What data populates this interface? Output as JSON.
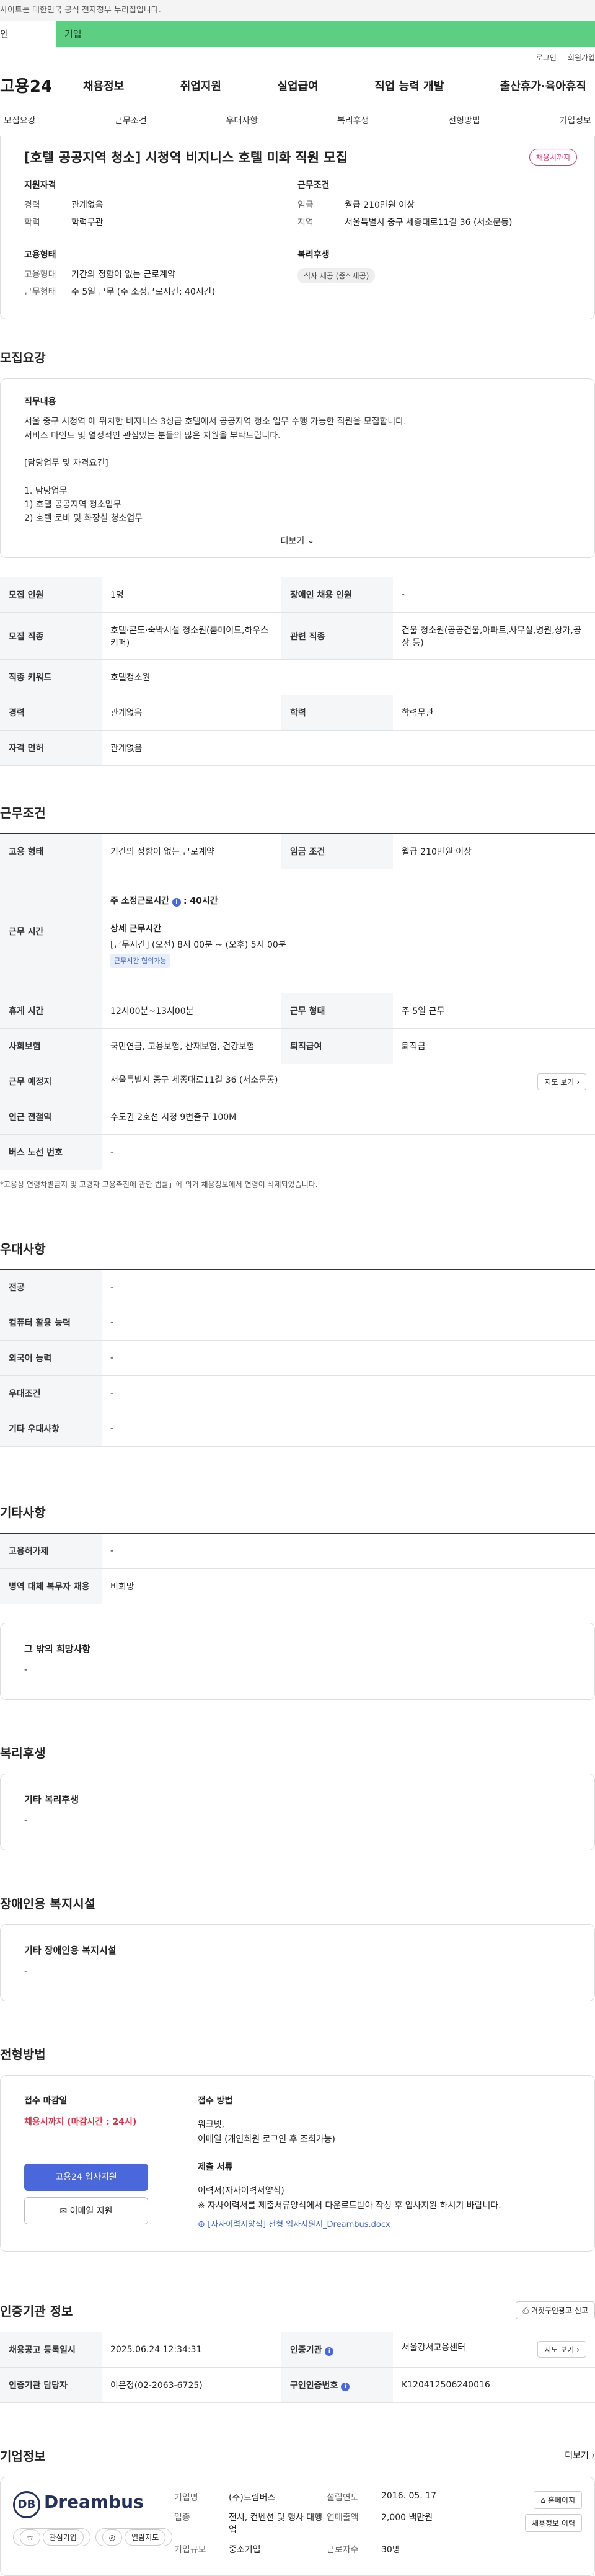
{
  "gov_notice": "사이트는 대한민국 공식 전자정부 누리집입니다.",
  "top_tabs": [
    "인",
    "기업"
  ],
  "util_links": [
    "로그인",
    "회원가입"
  ],
  "logo": "고용24",
  "gnb": [
    "채용정보",
    "취업지원",
    "실업급여",
    "직업 능력 개발",
    "출산휴가·육아휴직"
  ],
  "anchors": [
    "모집요강",
    "근무조건",
    "우대사항",
    "복리후생",
    "전형방법",
    "기업정보"
  ],
  "job": {
    "title": "[호텔 공공지역 청소] 시청역 비지니스 호텔 미화 직원 모집",
    "status": "채용시까지",
    "qualification": {
      "heading": "지원자격",
      "rows": [
        [
          "경력",
          "관계없음"
        ],
        [
          "학력",
          "학력무관"
        ]
      ]
    },
    "conditions": {
      "heading": "근무조건",
      "rows": [
        [
          "임금",
          "월급 210만원 이상"
        ],
        [
          "지역",
          "서울특별시 중구 세종대로11길 36 (서소문동)"
        ]
      ]
    },
    "employment": {
      "heading": "고용형태",
      "rows": [
        [
          "고용형태",
          "기간의 정함이 없는 근로계약"
        ],
        [
          "근무형태",
          "주 5일 근무 (주 소정근로시간: 40시간)"
        ]
      ]
    },
    "welfare": {
      "heading": "복리후생",
      "chip": "식사 제공 (중식제공)"
    }
  },
  "recruit": {
    "title": "모집요강",
    "duty_heading": "직무내용",
    "duty_lines": [
      "서울 중구 시청역 에 위치한 비지니스 3성급 호텔에서 공공지역 청소 업무 수행 가능한 직원을 모집합니다.",
      "서비스 마인드 및 열정적인 관심있는 분들의 많은 지원을 부탁드립니다.",
      "",
      "[담당업무 및 자격요건]",
      "",
      "1. 담당업무",
      " 1) 호텔 공공지역 청소업무",
      " 2) 호텔 로비 및 화장실 청소업무"
    ],
    "more": "더보기",
    "table": [
      [
        "모집 인원",
        "1명",
        "장애인 채용 인원",
        "-"
      ],
      [
        "모집 직종",
        "호텔·콘도·숙박시설 청소원(룸메이드,하우스키퍼)",
        "관련 직종",
        "건물 청소원(공공건물,아파트,사무실,병원,상가,공장 등)"
      ],
      [
        "직종 키워드",
        "호텔청소원"
      ],
      [
        "경력",
        "관계없음",
        "학력",
        "학력무관"
      ],
      [
        "자격 면허",
        "관계없음"
      ]
    ]
  },
  "work": {
    "title": "근무조건",
    "type": [
      "고용 형태",
      "기간의 정함이 없는 근로계약",
      "임금 조건",
      "월급 210만원 이상"
    ],
    "hours_label": "근무 시간",
    "hours_week": "주 소정근로시간",
    "hours_week_val": ": 40시간",
    "hours_detail_head": "상세 근무시간",
    "hours_detail": "[근무시간] (오전) 8시 00분 ~ (오후) 5시 00분",
    "hours_tag": "근무시간 협의가능",
    "rows": [
      [
        "휴게 시간",
        "12시00분~13시00분",
        "근무 형태",
        "주 5일 근무"
      ],
      [
        "사회보험",
        "국민연금, 고용보험, 산재보험, 건강보험",
        "퇴직급여",
        "퇴직금"
      ]
    ],
    "place_label": "근무 예정지",
    "place": "서울특별시 중구 세종대로11길 36 (서소문동)",
    "map_btn": "지도 보기",
    "station_label": "인근 전철역",
    "station": "수도권 2호선 시청 9번출구 100M",
    "bus_label": "버스 노선 번호",
    "bus": "-",
    "note": "*고용상 연령차별금지 및 고령자 고용촉진에 관한 법률」에 의거 채용정보에서 연령이 삭제되었습니다."
  },
  "pref": {
    "title": "우대사항",
    "rows": [
      [
        "전공",
        "-"
      ],
      [
        "컴퓨터 활용 능력",
        "-"
      ],
      [
        "외국어 능력",
        "-"
      ],
      [
        "우대조건",
        "-"
      ],
      [
        "기타 우대사항",
        "-"
      ]
    ]
  },
  "etc": {
    "title": "기타사항",
    "rows": [
      [
        "고용허가제",
        "-"
      ],
      [
        "병역 대체 복무자 채용",
        "비희망"
      ]
    ],
    "other_heading": "그 밖의 희망사항",
    "other_val": "-"
  },
  "benefit": {
    "title": "복리후생",
    "heading": "기타 복리후생",
    "val": "-"
  },
  "disab": {
    "title": "장애인용 복지시설",
    "heading": "기타 장애인용 복지시설",
    "val": "-"
  },
  "apply": {
    "title": "전형방법",
    "deadline_head": "접수 마감일",
    "deadline": "채용시까지 (마감시간 : 24시)",
    "btn_apply": "고용24 입사지원",
    "btn_mail": "이메일 지원",
    "method_head": "접수 방법",
    "method": [
      "워크넷,",
      "이메일 (개인회원 로그인 후 조회가능)"
    ],
    "docs_head": "제출 서류",
    "docs": [
      "이력서(자사이력서양식)",
      "※ 자사이력서를 제출서류양식에서 다운로드받아 작성 후 입사지원 하시기 바랍니다."
    ],
    "file": "[자사이력서양식] 전형 입사지원서_Dreambus.docx"
  },
  "agency": {
    "title": "인증기관 정보",
    "report": "거짓구인광고 신고",
    "rows": [
      [
        "채용공고 등록일시",
        "2025.06.24 12:34:31",
        "인증기관",
        "서울강서고용센터"
      ],
      [
        "인증기관 담당자",
        "이은정(02-2063-6725)",
        "구인인증번호",
        "K120412506240016"
      ]
    ],
    "map": "지도 보기"
  },
  "company": {
    "title": "기업정보",
    "more": "더보기",
    "logo_text": "Dreambus",
    "logo_mark": "DB",
    "btns": [
      "관심기업",
      "열람지도"
    ],
    "info": [
      [
        "기업명",
        "(주)드림버스",
        "설립연도",
        "2016. 05. 17"
      ],
      [
        "업종",
        "전시, 컨벤션 및 행사 대행업",
        "연매출액",
        "2,000 백만원"
      ],
      [
        "기업규모",
        "중소기업",
        "근로자수",
        "30명"
      ]
    ],
    "side": [
      "홈페이지",
      "채용정보 이력"
    ]
  }
}
